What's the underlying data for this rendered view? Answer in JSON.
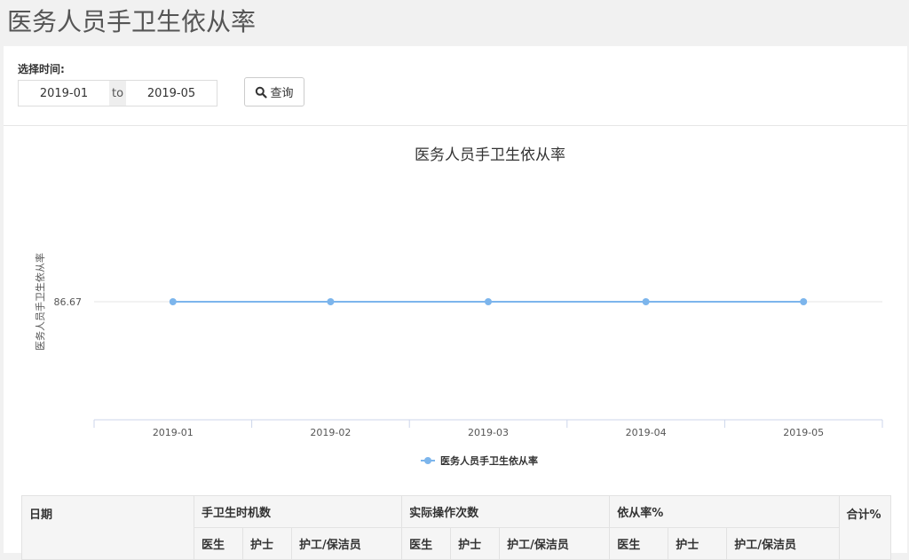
{
  "page": {
    "title": "医务人员手卫生依从率"
  },
  "filter": {
    "label": "选择时间:",
    "start_value": "2019-01",
    "separator": "to",
    "end_value": "2019-05",
    "query_label": "查询",
    "query_icon": "search-icon"
  },
  "chart_data": {
    "type": "line",
    "title": "医务人员手卫生依从率",
    "ylabel": "医务人员手卫生依从率",
    "xlabel": "",
    "categories": [
      "2019-01",
      "2019-02",
      "2019-03",
      "2019-04",
      "2019-05"
    ],
    "series": [
      {
        "name": "医务人员手卫生依从率",
        "values": [
          86.67,
          86.67,
          86.67,
          86.67,
          86.67
        ],
        "color": "#7cb5ec"
      }
    ],
    "y_tick_labels": [
      "86.67"
    ],
    "grid": true,
    "legend": "bottom-center"
  },
  "table": {
    "headers": {
      "date": "日期",
      "opportunities": "手卫生时机数",
      "actual": "实际操作次数",
      "compliance": "依从率%",
      "total": "合计%"
    },
    "sub_headers": [
      "医生",
      "护士",
      "护工/保洁员"
    ]
  }
}
